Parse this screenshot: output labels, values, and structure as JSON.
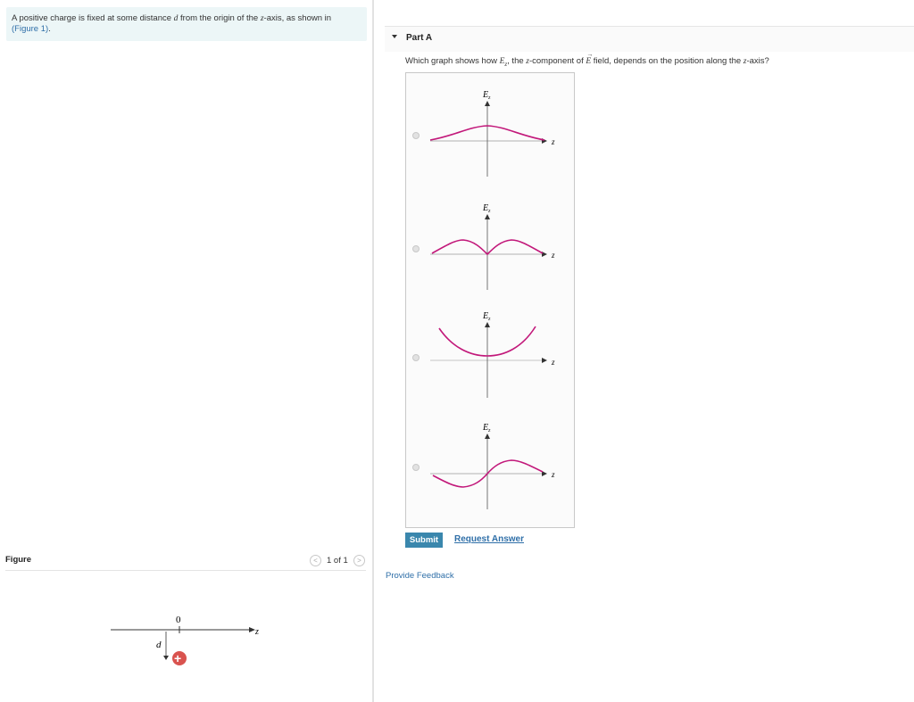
{
  "intro": {
    "prefix": "A positive charge is fixed at some distance ",
    "d": "d",
    "mid": " from the origin of the ",
    "zvar": "z",
    "suffix": "-axis, as shown in",
    "figure_link": "(Figure 1)",
    "end": "."
  },
  "part_a": {
    "title": "Part A",
    "question_pre": "Which graph shows how ",
    "Ez_sym": "E",
    "Ez_sub": "z",
    "question_mid1": ", the ",
    "zvar": "z",
    "question_mid2": "-component of ",
    "E_vec": "E",
    "question_post1": " field, depends on the position along the ",
    "zvar2": "z",
    "question_post2": "-axis?"
  },
  "choices": {
    "ylabel": "E",
    "ylabel_sub": "z",
    "xlabel": "z",
    "options": [
      {
        "name": "option-1-bell-positive"
      },
      {
        "name": "option-2-double-hump"
      },
      {
        "name": "option-3-bowl-above-axis"
      },
      {
        "name": "option-4-odd-function"
      }
    ]
  },
  "buttons": {
    "submit": "Submit",
    "request_answer": "Request Answer",
    "feedback": "Provide Feedback"
  },
  "figure": {
    "label": "Figure",
    "pager": "1 of 1",
    "prev_icon": "<",
    "next_icon": ">",
    "origin_label": "0",
    "axis_label": "z",
    "distance_label": "d",
    "charge_symbol": "+"
  },
  "colors": {
    "curve": "#c2187a",
    "link": "#2f6fa8",
    "submit_bg": "#3a87ad",
    "charge": "#d9534f",
    "intro_bg": "#ecf6f7"
  }
}
